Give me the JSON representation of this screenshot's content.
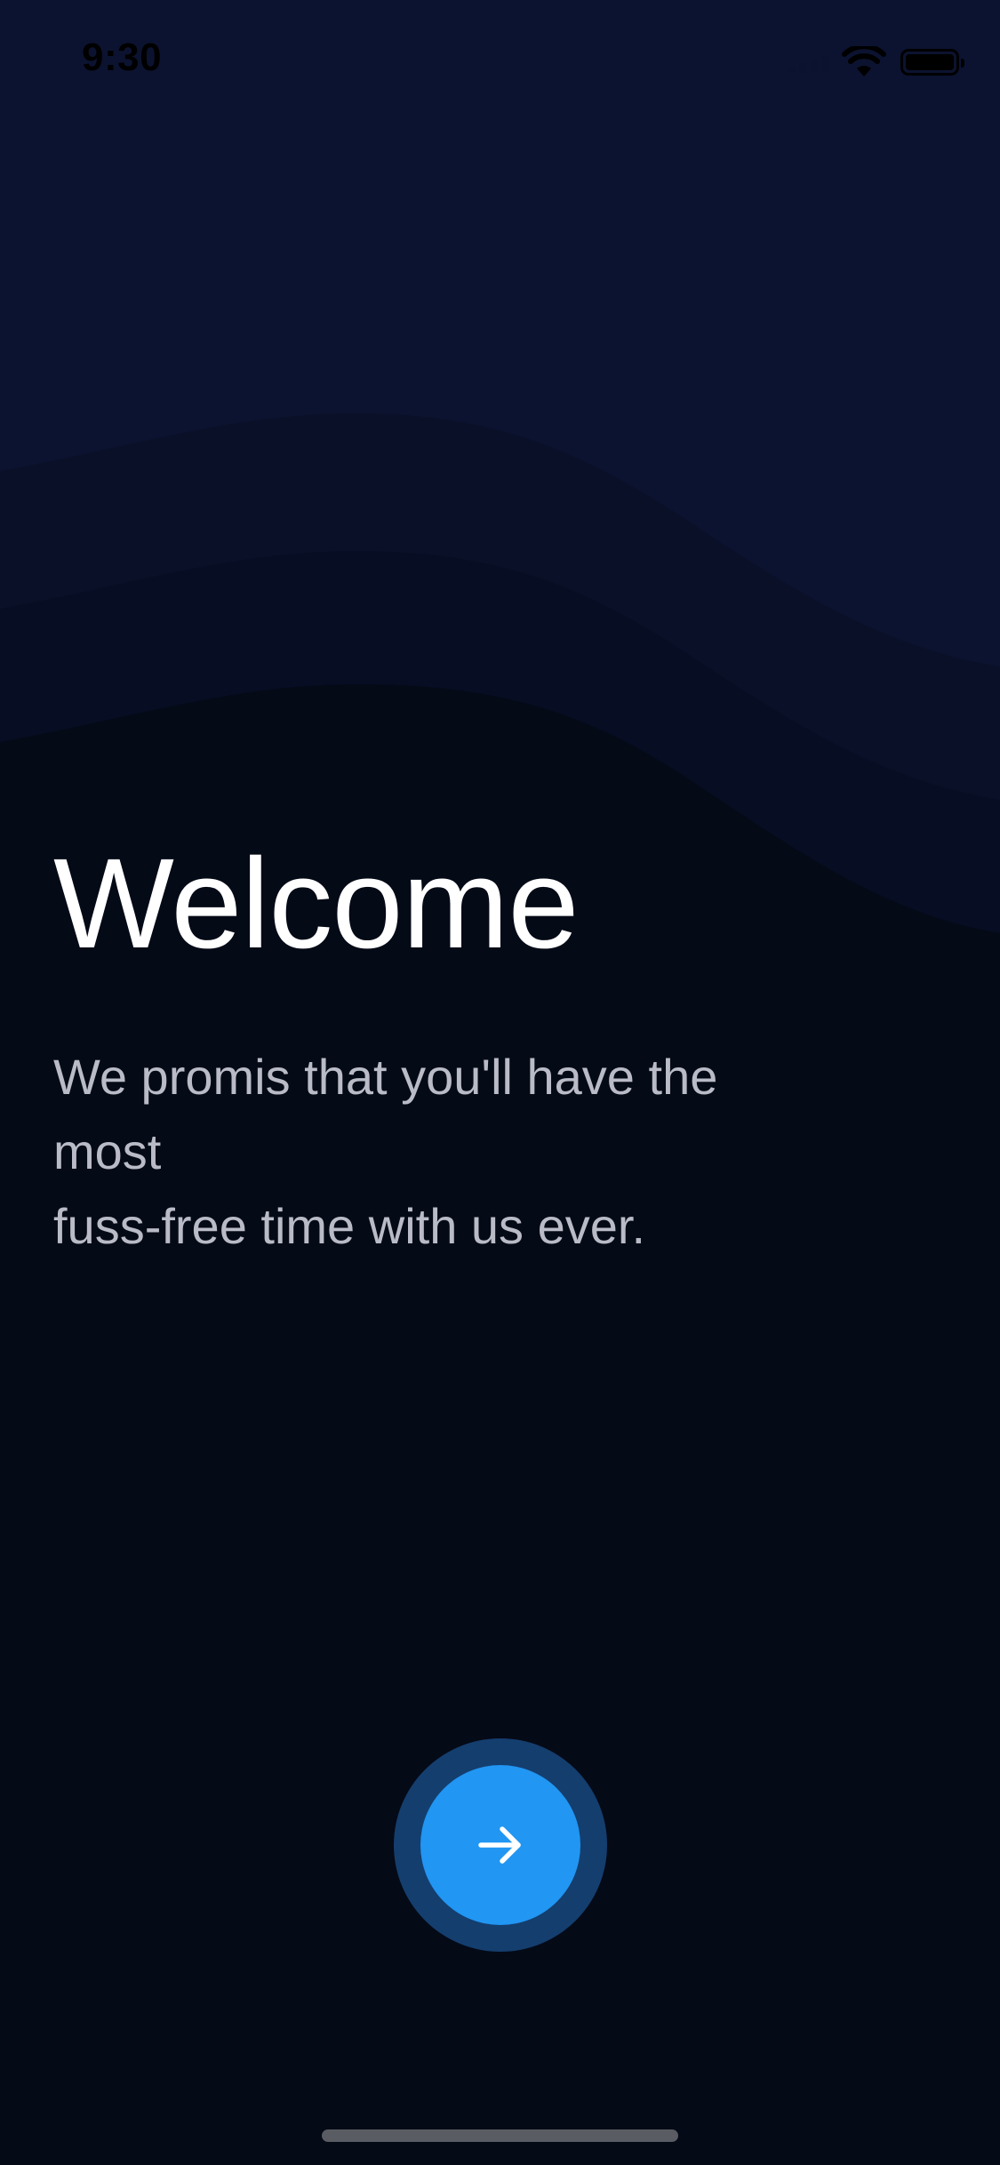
{
  "status_bar": {
    "time": "9:30"
  },
  "welcome": {
    "title": "Welcome",
    "subtitle_lines": [
      "We promis that you'll have the",
      "most",
      "fuss-free time with us ever."
    ]
  },
  "next_button": {
    "icon": "arrow-right-icon",
    "aria_label": "Next"
  },
  "colors": {
    "background": "#050a17",
    "wave_top": "#0c1330",
    "accent": "#2196f3",
    "accent_ring": "#143e6e",
    "title": "#ffffff",
    "subtitle": "#b9bcc6"
  }
}
